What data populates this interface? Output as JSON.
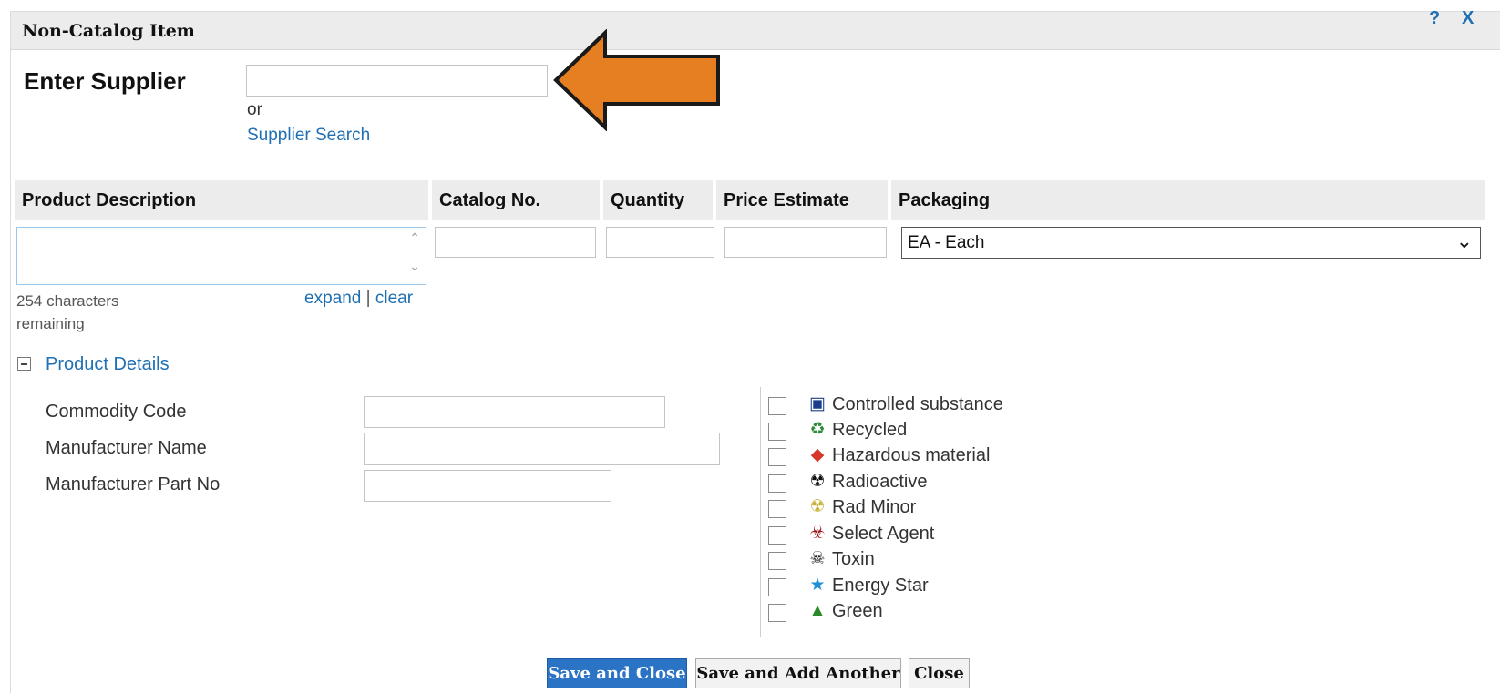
{
  "dialog": {
    "title": "Non-Catalog Item",
    "help": "?",
    "close": "X"
  },
  "supplier": {
    "label": "Enter Supplier",
    "value": "",
    "or": "or",
    "search_link": "Supplier Search"
  },
  "columns": [
    "Product Description",
    "Catalog No.",
    "Quantity",
    "Price Estimate",
    "Packaging"
  ],
  "description": {
    "value": "",
    "chars_remaining": "254 characters remaining",
    "expand": "expand",
    "separator": "|",
    "clear": "clear"
  },
  "catalog_no": "",
  "quantity": "",
  "price_estimate": "",
  "packaging": {
    "selected": "EA - Each"
  },
  "product_details": {
    "toggle_label": "Product Details",
    "fields": [
      {
        "label": "Commodity Code",
        "value": ""
      },
      {
        "label": "Manufacturer Name",
        "value": ""
      },
      {
        "label": "Manufacturer Part No",
        "value": ""
      }
    ]
  },
  "flags": [
    {
      "label": "Controlled substance",
      "icon": "controlled-substance-icon",
      "checked": false
    },
    {
      "label": "Recycled",
      "icon": "recycle-icon",
      "checked": false
    },
    {
      "label": "Hazardous material",
      "icon": "hazard-diamond-icon",
      "checked": false
    },
    {
      "label": "Radioactive",
      "icon": "radioactive-icon",
      "checked": false
    },
    {
      "label": "Rad Minor",
      "icon": "rad-minor-icon",
      "checked": false
    },
    {
      "label": "Select Agent",
      "icon": "biohazard-icon",
      "checked": false
    },
    {
      "label": "Toxin",
      "icon": "skull-icon",
      "checked": false
    },
    {
      "label": "Energy Star",
      "icon": "energy-star-icon",
      "checked": false
    },
    {
      "label": "Green",
      "icon": "tree-icon",
      "checked": false
    }
  ],
  "buttons": {
    "save_close": "Save and Close",
    "save_another": "Save and Add Another",
    "close": "Close"
  },
  "colors": {
    "link": "#1f6fb3",
    "primary_button": "#2b74c5",
    "arrow": "#e67e22",
    "header_bg": "#ececec"
  }
}
